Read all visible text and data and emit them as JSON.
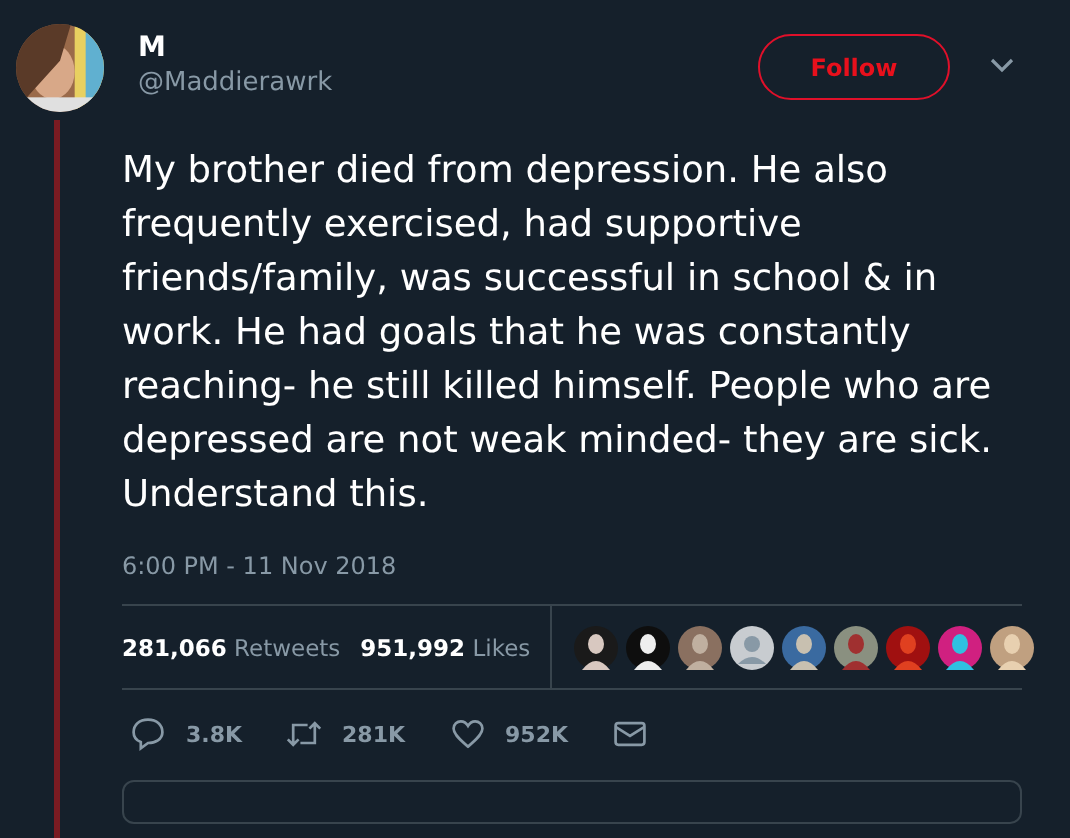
{
  "author": {
    "name": "M",
    "handle": "@Maddierawrk"
  },
  "follow_button": {
    "label": "Follow"
  },
  "tweet_text": "My brother died from depression. He also frequently exercised, had supportive friends/family, was successful in school & in work. He had goals that he was constantly reaching- he still killed himself. People who are depressed are not weak minded- they are sick. Understand this.",
  "timestamp": "6:00 PM - 11 Nov 2018",
  "stats": [
    {
      "count": "281,066",
      "label": "Retweets"
    },
    {
      "count": "951,992",
      "label": "Likes"
    }
  ],
  "liker_avatars": [
    {
      "kind": "picture"
    },
    {
      "kind": "picture"
    },
    {
      "kind": "picture"
    },
    {
      "kind": "default"
    },
    {
      "kind": "picture"
    },
    {
      "kind": "picture"
    },
    {
      "kind": "picture"
    },
    {
      "kind": "picture"
    },
    {
      "kind": "picture"
    }
  ],
  "actions": [
    {
      "kind": "reply",
      "count": "3.8K"
    },
    {
      "kind": "retweet",
      "count": "281K"
    },
    {
      "kind": "like",
      "count": "952K"
    },
    {
      "kind": "message"
    }
  ]
}
